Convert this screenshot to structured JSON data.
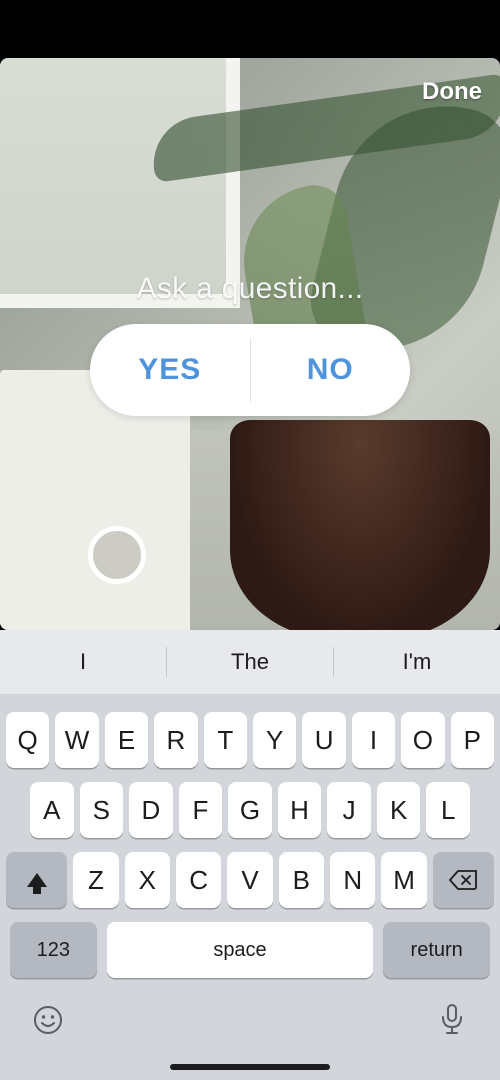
{
  "header": {
    "done_label": "Done"
  },
  "poll": {
    "prompt_placeholder": "Ask a question...",
    "option_yes": "YES",
    "option_no": "NO"
  },
  "keyboard": {
    "suggestions": [
      "I",
      "The",
      "I'm"
    ],
    "row1": [
      "Q",
      "W",
      "E",
      "R",
      "T",
      "Y",
      "U",
      "I",
      "O",
      "P"
    ],
    "row2": [
      "A",
      "S",
      "D",
      "F",
      "G",
      "H",
      "J",
      "K",
      "L"
    ],
    "row3": [
      "Z",
      "X",
      "C",
      "V",
      "B",
      "N",
      "M"
    ],
    "numeric_label": "123",
    "space_label": "space",
    "return_label": "return"
  }
}
